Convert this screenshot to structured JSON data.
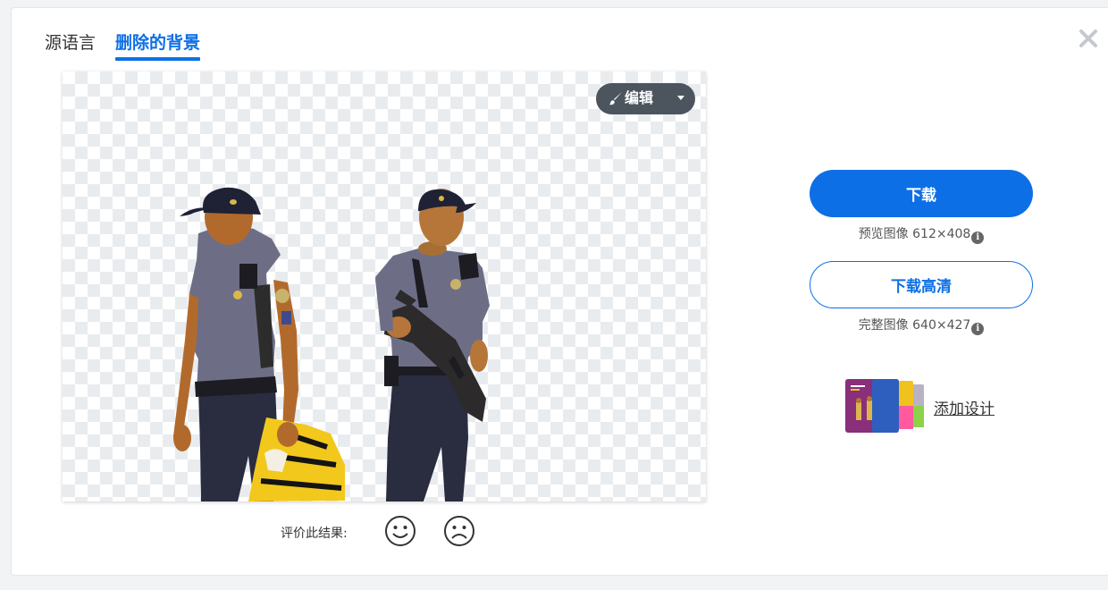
{
  "tabs": {
    "original": "源语言",
    "removed": "删除的背景"
  },
  "editor": {
    "edit_label": "编辑",
    "edit_icon": "brush-icon",
    "menu_icon": "caret-down-icon"
  },
  "rating": {
    "label": "评价此结果:",
    "happy_icon": "smiley-face-icon",
    "sad_icon": "frown-face-icon"
  },
  "download": {
    "button_label": "下载",
    "preview_info": "预览图像 612×408",
    "hd_button_label": "下载高清",
    "full_info": "完整图像 640×427",
    "info_icon": "info-icon"
  },
  "design": {
    "link_label": "添加设计"
  },
  "colors": {
    "accent": "#0d6fe6",
    "edit_button": "#4c555e",
    "checker": "#e9ecef",
    "uniform": "#6d6e86",
    "trousers": "#2a2c40",
    "caution_tape": "#f2c81c"
  }
}
